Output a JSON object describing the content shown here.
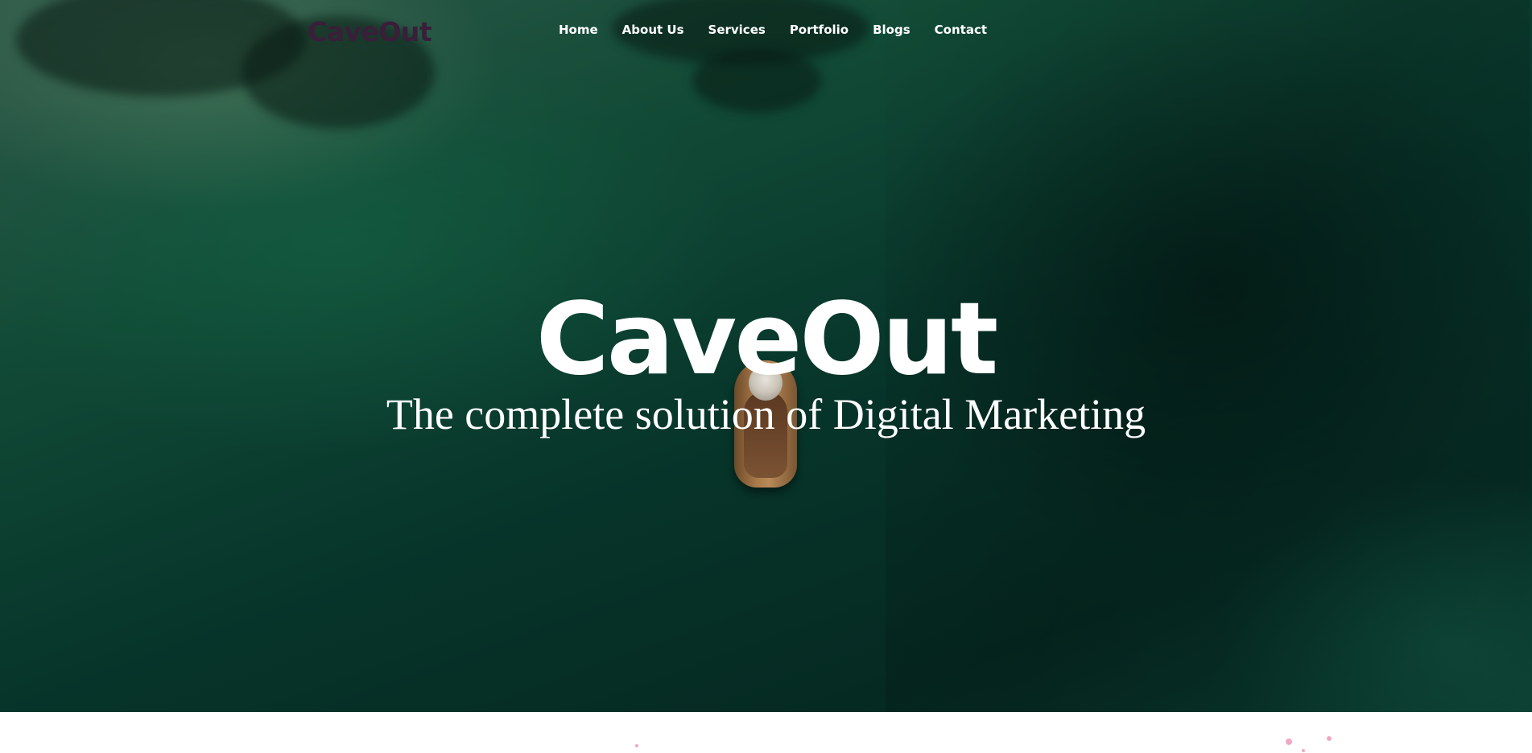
{
  "site": {
    "logo_text": "CaveOut"
  },
  "nav": {
    "items": [
      {
        "label": "Home"
      },
      {
        "label": "About Us"
      },
      {
        "label": "Services"
      },
      {
        "label": "Portfolio"
      },
      {
        "label": "Blogs"
      },
      {
        "label": "Contact"
      }
    ]
  },
  "hero": {
    "title": "CaveOut",
    "subtitle": "The complete solution of Digital Marketing"
  },
  "colors": {
    "logo": "#3a1e3a",
    "nav_text": "#ffffff",
    "hero_bg": "#07352a",
    "hero_text": "#ffffff",
    "accent_dots": "#f0a8c4"
  }
}
